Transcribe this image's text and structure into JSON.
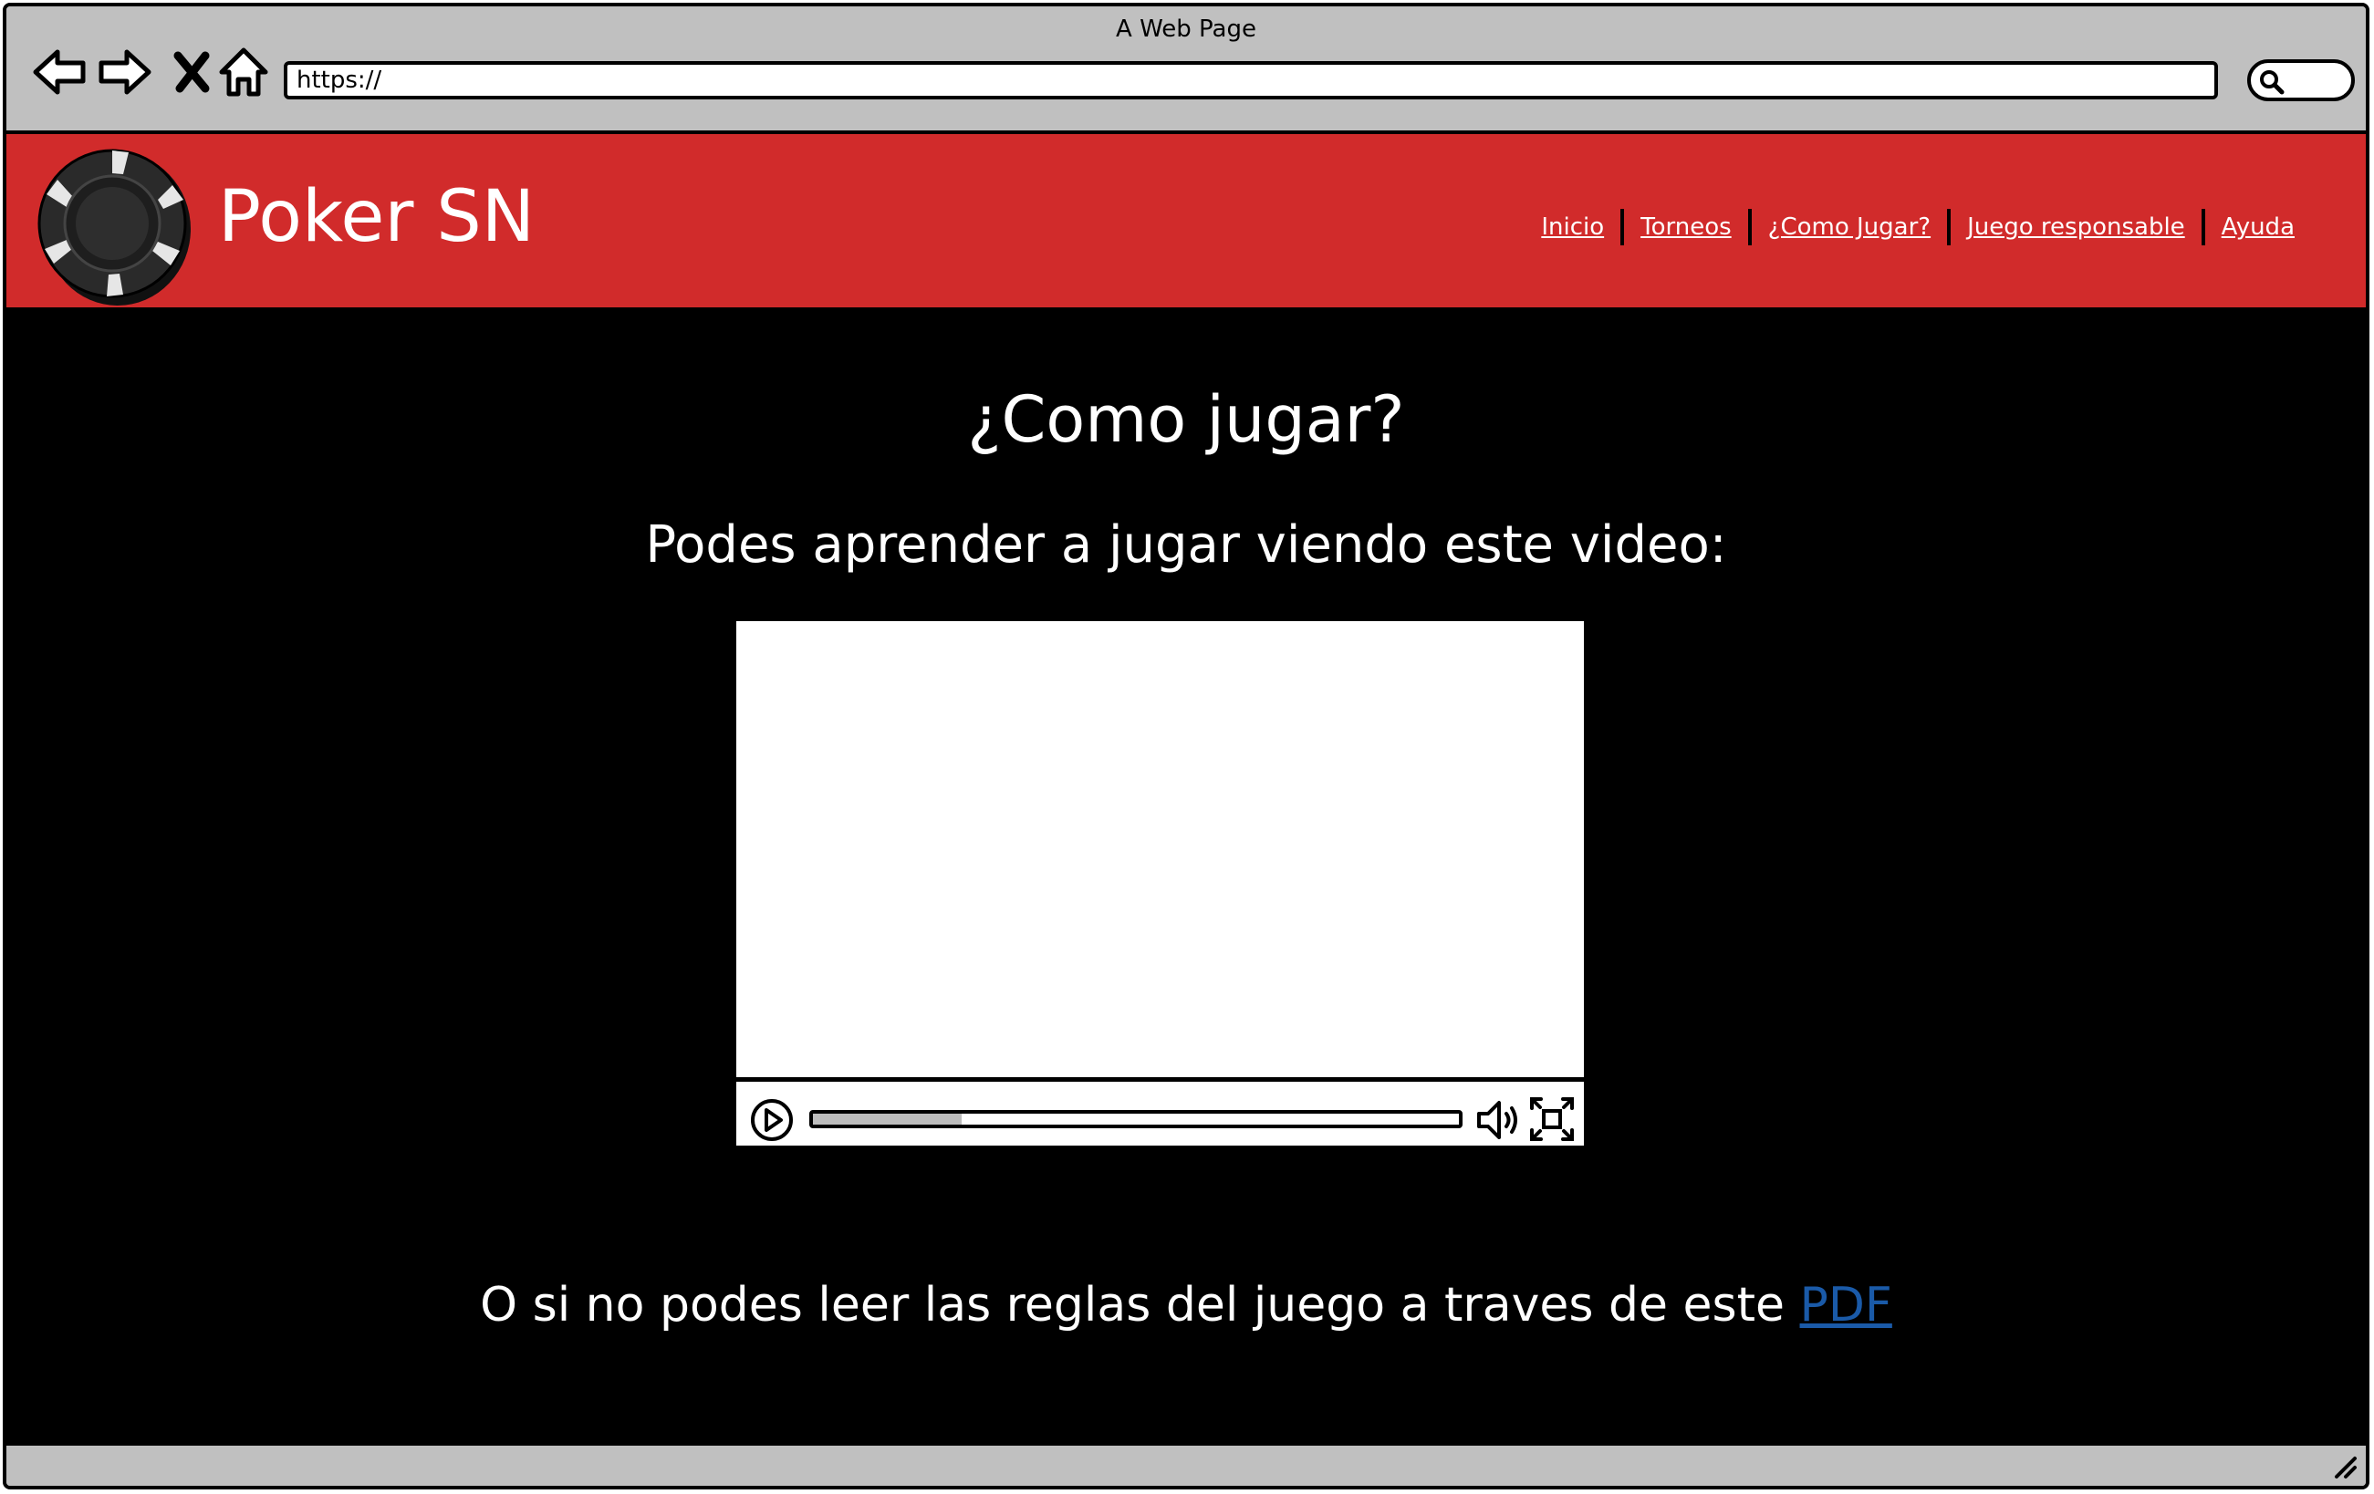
{
  "browser": {
    "title": "A Web Page",
    "url": "https://",
    "icons": [
      "back-arrow-icon",
      "forward-arrow-icon",
      "close-x-icon",
      "home-icon",
      "search-icon",
      "resize-grip-icon"
    ]
  },
  "header": {
    "brand": "Poker SN",
    "logo_icon": "poker-chip-icon",
    "background_color": "#d12b2b",
    "nav": [
      {
        "label": "Inicio"
      },
      {
        "label": "Torneos"
      },
      {
        "label": "¿Como Jugar?"
      },
      {
        "label": "Juego responsable"
      },
      {
        "label": "Ayuda"
      }
    ]
  },
  "main": {
    "title": "¿Como jugar?",
    "subtitle": "Podes aprender a jugar viendo este video:",
    "video": {
      "progress": 0.23,
      "icons": [
        "play-icon",
        "volume-icon",
        "fullscreen-icon"
      ]
    },
    "footer_text": "O si no podes leer las reglas del juego a traves de este",
    "pdf_link": "PDF",
    "link_color": "#1a5aa8"
  }
}
